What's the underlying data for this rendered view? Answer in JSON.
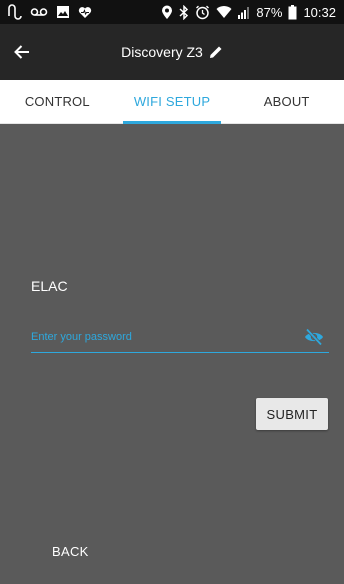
{
  "status_bar": {
    "battery_text": "87%",
    "time": "10:32",
    "icons": [
      "sync-icon",
      "voicemail-icon",
      "image-icon",
      "heart-icon",
      "location-icon",
      "bluetooth-icon",
      "alarm-icon",
      "wifi-icon",
      "signal-icon",
      "battery-icon"
    ]
  },
  "app_bar": {
    "title": "Discovery Z3",
    "back_icon": "back-arrow-icon",
    "edit_icon": "pencil-icon"
  },
  "tabs": [
    {
      "label": "CONTROL",
      "active": false
    },
    {
      "label": "WIFI SETUP",
      "active": true
    },
    {
      "label": "ABOUT",
      "active": false
    }
  ],
  "wifi_setup": {
    "network_name": "ELAC",
    "password_placeholder": "Enter your password",
    "password_value": "",
    "visibility_icon": "eye-off-icon",
    "submit_label": "SUBMIT",
    "back_label": "BACK"
  },
  "colors": {
    "accent": "#2ea8dd",
    "app_bar": "#262626",
    "status_bar": "#111111",
    "content_bg": "#5a5a5a",
    "tab_bg": "#ffffff"
  }
}
